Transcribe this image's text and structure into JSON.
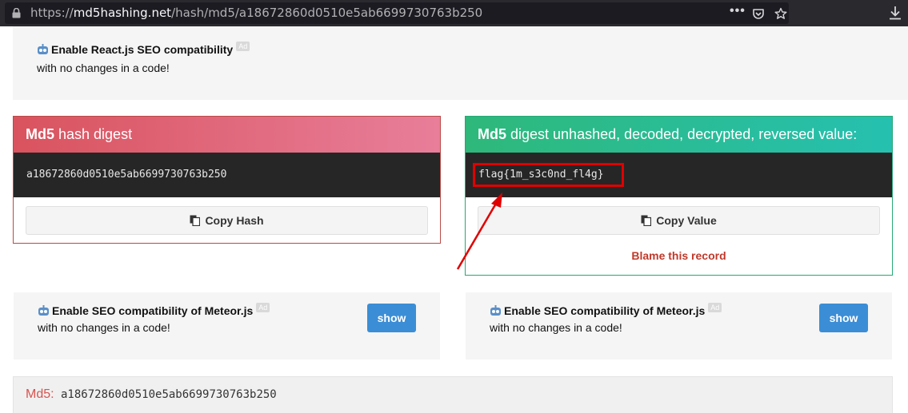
{
  "browser": {
    "url_prefix": "https://",
    "url_domain": "md5hashing.net",
    "url_path": "/hash/md5/a18672860d0510e5ab6699730763b250",
    "meatball": "•••"
  },
  "ad_top": {
    "title": "Enable React.js SEO compatibility",
    "badge": "Ad",
    "subtitle": "with no changes in a code!"
  },
  "left_panel": {
    "title_bold": "Md5",
    "title_rest": " hash digest",
    "code": "a18672860d0510e5ab6699730763b250",
    "copy_label": "Copy Hash"
  },
  "right_panel": {
    "title_bold": "Md5",
    "title_rest": " digest unhashed, decoded, decrypted, reversed value:",
    "code": "flag{1m_s3c0nd_fl4g}",
    "copy_label": "Copy Value",
    "blame_label": "Blame this record"
  },
  "ad_mid_left": {
    "title": "Enable SEO compatibility of Meteor.js",
    "badge": "Ad",
    "subtitle": "with no changes in a code!",
    "button": "show"
  },
  "ad_mid_right": {
    "title": "Enable SEO compatibility of Meteor.js",
    "badge": "Ad",
    "subtitle": "with no changes in a code!",
    "button": "show"
  },
  "footer": {
    "label": "Md5:",
    "value": " a18672860d0510e5ab6699730763b250"
  },
  "colors": {
    "left_panel_accent": "#d9535e",
    "right_panel_accent": "#2eb87a",
    "annotation_red": "#e00000",
    "show_button": "#3b8ed6"
  }
}
